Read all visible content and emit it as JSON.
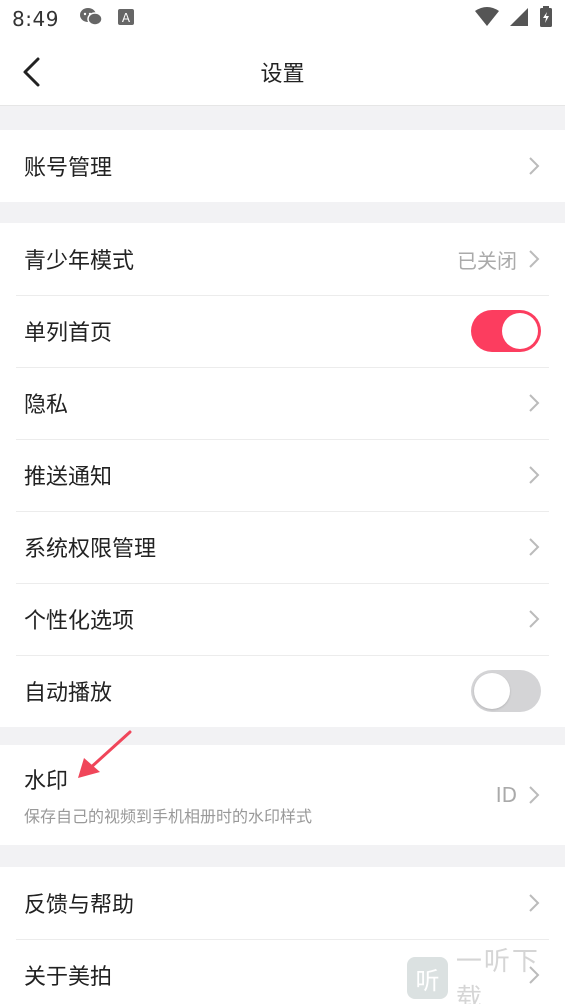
{
  "status_bar": {
    "time": "8:49",
    "icons_left": [
      "wechat-icon",
      "app-a-icon"
    ],
    "icons_right": [
      "wifi-icon",
      "cell-signal-icon",
      "battery-icon"
    ]
  },
  "header": {
    "title": "设置",
    "back_icon": "chevron-left-icon"
  },
  "group_account": {
    "items": [
      {
        "label": "账号管理"
      }
    ]
  },
  "group_main": {
    "items": [
      {
        "label": "青少年模式",
        "value": "已关闭"
      },
      {
        "label": "单列首页",
        "toggle": "on"
      },
      {
        "label": "隐私"
      },
      {
        "label": "推送通知"
      },
      {
        "label": "系统权限管理"
      },
      {
        "label": "个性化选项"
      },
      {
        "label": "自动播放",
        "toggle": "off"
      }
    ]
  },
  "group_watermark": {
    "label": "水印",
    "subtitle": "保存自己的视频到手机相册时的水印样式",
    "value": "ID"
  },
  "group_help": {
    "items": [
      {
        "label": "反馈与帮助"
      },
      {
        "label": "关于美拍"
      }
    ]
  },
  "colors": {
    "accent": "#fc3d5f",
    "toggle_off": "#d4d4d6",
    "annotation_arrow": "#f0465a"
  },
  "site_watermark": {
    "text": "一听下载",
    "logo_char": "听"
  }
}
